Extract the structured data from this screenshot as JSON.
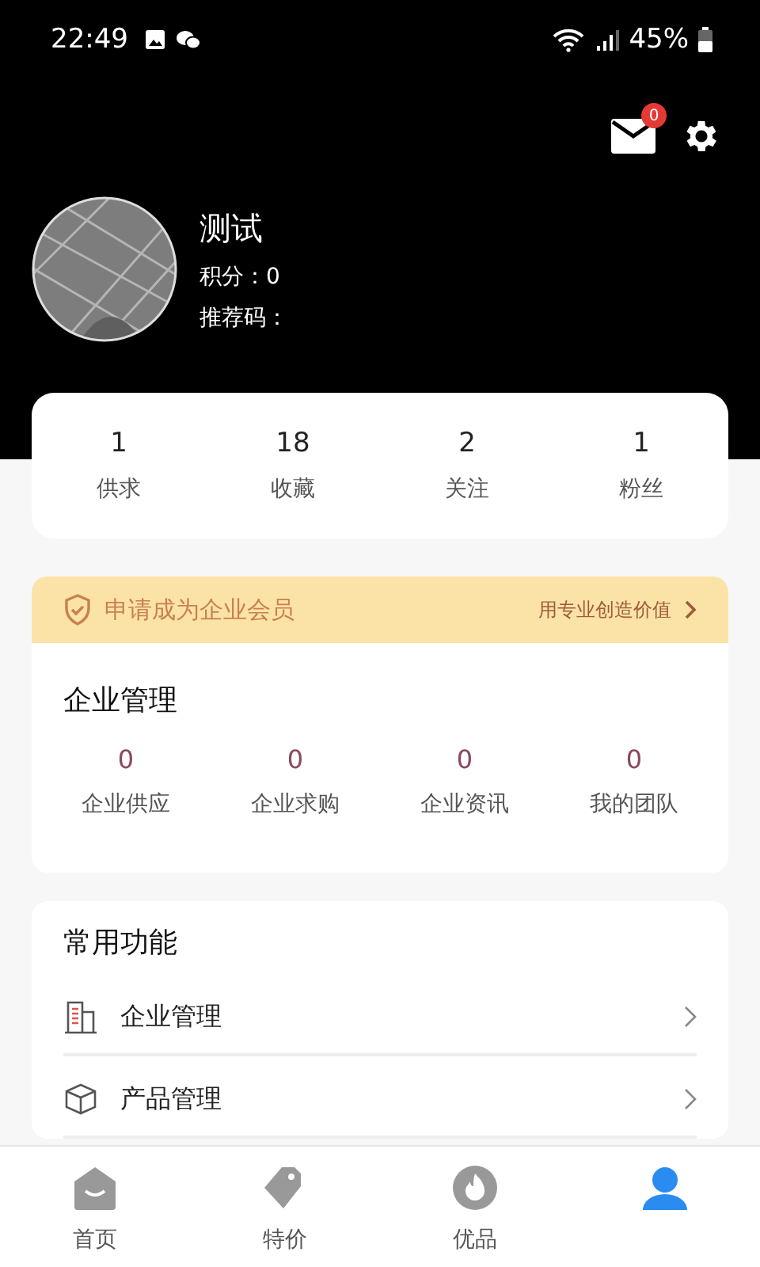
{
  "status_bar": {
    "time": "22:49",
    "battery": "45%"
  },
  "header": {
    "mail_badge": "0"
  },
  "profile": {
    "name": "测试",
    "points": "积分：0",
    "referral": "推荐码："
  },
  "stats": [
    {
      "value": "1",
      "label": "供求"
    },
    {
      "value": "18",
      "label": "收藏"
    },
    {
      "value": "2",
      "label": "关注"
    },
    {
      "value": "1",
      "label": "粉丝"
    }
  ],
  "member_banner": {
    "title": "申请成为企业会员",
    "link": "用专业创造价值"
  },
  "enterprise": {
    "title": "企业管理",
    "items": [
      {
        "value": "0",
        "label": "企业供应"
      },
      {
        "value": "0",
        "label": "企业求购"
      },
      {
        "value": "0",
        "label": "企业资讯"
      },
      {
        "value": "0",
        "label": "我的团队"
      }
    ]
  },
  "functions": {
    "title": "常用功能",
    "items": [
      {
        "kind": "building",
        "label": "企业管理"
      },
      {
        "kind": "box",
        "label": "产品管理"
      }
    ]
  },
  "tab_bar": [
    {
      "kind": "home",
      "label": "首页",
      "selected": false
    },
    {
      "kind": "tag",
      "label": "特价",
      "selected": false
    },
    {
      "kind": "fire",
      "label": "优品",
      "selected": false
    },
    {
      "kind": "person",
      "selected": true
    }
  ]
}
